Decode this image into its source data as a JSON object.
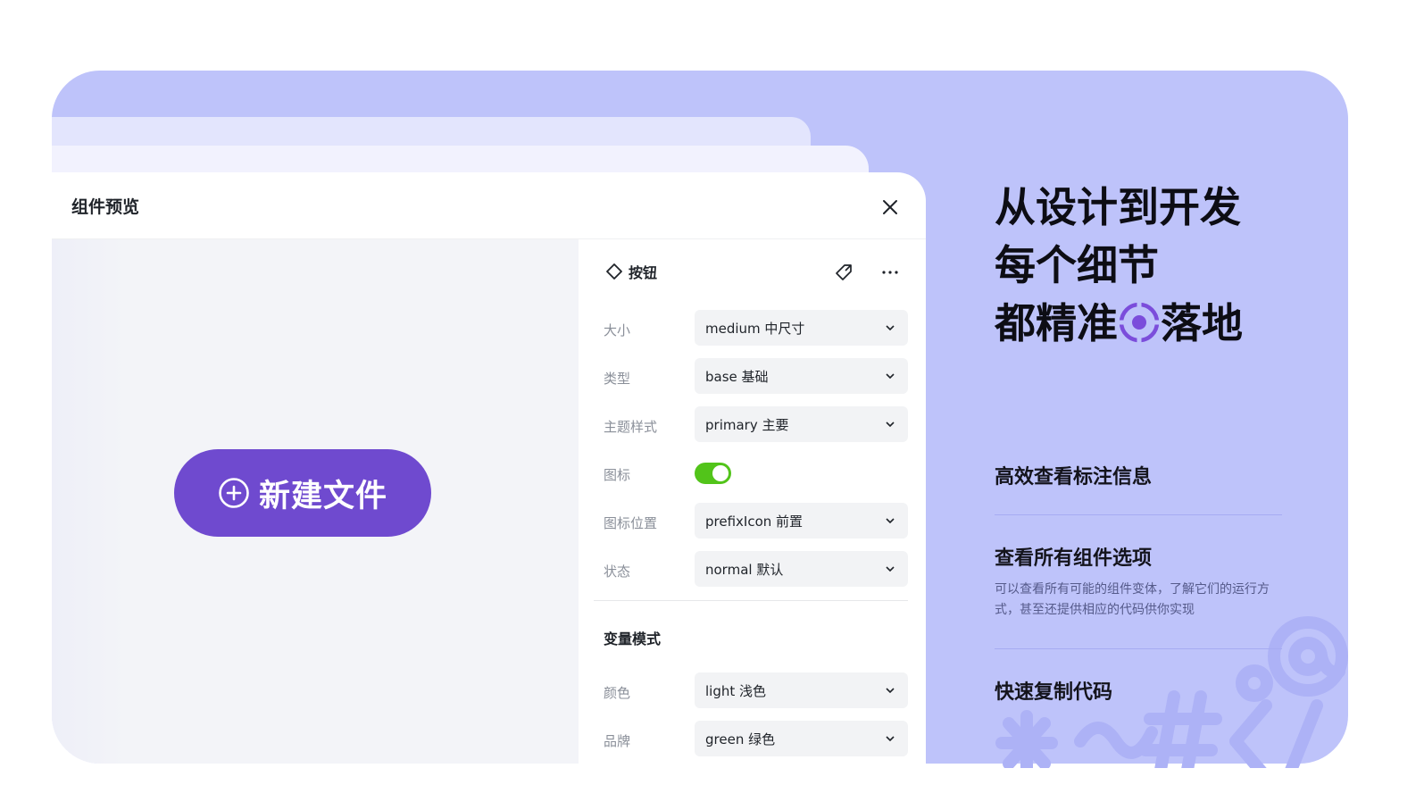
{
  "panel": {
    "title": "组件预览",
    "preview_button": {
      "label": "新建文件",
      "icon": "plus-circle-icon"
    }
  },
  "properties": {
    "component_name": "按钮",
    "rows": [
      {
        "label": "大小",
        "value": "medium 中尺寸"
      },
      {
        "label": "类型",
        "value": "base 基础"
      },
      {
        "label": "主题样式",
        "value": "primary 主要"
      },
      {
        "label": "图标",
        "toggle": true
      },
      {
        "label": "图标位置",
        "value": "prefixIcon 前置"
      },
      {
        "label": "状态",
        "value": "normal 默认"
      }
    ],
    "variables_section": {
      "title": "变量模式",
      "rows": [
        {
          "label": "颜色",
          "value": "light 浅色"
        },
        {
          "label": "品牌",
          "value": "green 绿色"
        }
      ]
    }
  },
  "marketing": {
    "headline_line1": "从设计到开发",
    "headline_line2": "每个细节",
    "headline_line3a": "都精准",
    "headline_line3b": "落地",
    "features": [
      {
        "title": "高效查看标注信息"
      },
      {
        "title": "查看所有组件选项",
        "desc": "可以查看所有可能的组件变体，了解它们的运行方式，甚至还提供相应的代码供你实现"
      },
      {
        "title": "快速复制代码"
      }
    ]
  },
  "colors": {
    "background_card": "#bec3fa",
    "primary_button": "#6f4acf",
    "toggle_on": "#52c41a",
    "accent_target": "#7b4ddb"
  }
}
